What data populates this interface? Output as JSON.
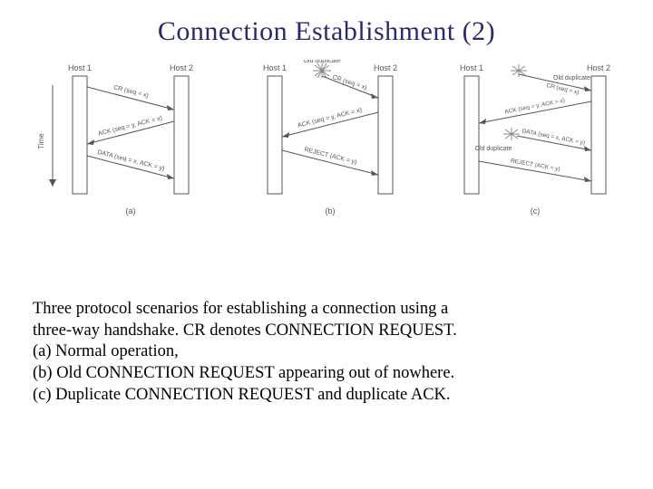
{
  "title": "Connection Establishment (2)",
  "panels": [
    {
      "label": "(a)",
      "host_left": "Host 1",
      "host_right": "Host 2",
      "time_label": "Time",
      "old_duplicate_top": false,
      "old_duplicate_mid": false,
      "messages": [
        "CR (seq = x)",
        "ACK (seq = y, ACK = x)",
        "DATA (seq = x, ACK = y)"
      ]
    },
    {
      "label": "(b)",
      "host_left": "Host 1",
      "host_right": "Host 2",
      "time_label": "",
      "old_duplicate_top": true,
      "old_duplicate_mid": false,
      "messages": [
        "CR (seq = x)",
        "ACK (seq = y, ACK = x)",
        "REJECT (ACK = y)"
      ]
    },
    {
      "label": "(c)",
      "host_left": "Host 1",
      "host_right": "Host 2",
      "time_label": "",
      "old_duplicate_top": true,
      "old_duplicate_mid": true,
      "messages": [
        "CR (seq = x)",
        "ACK (seq = y, ACK = x)",
        "DATA (seq = x, ACK = y)",
        "REJECT (ACK = y)"
      ]
    }
  ],
  "caption": {
    "line1": "Three protocol scenarios for establishing a connection using a",
    "line2": "three-way handshake.  CR denotes CONNECTION REQUEST.",
    "line3": "(a) Normal operation,",
    "line4": "(b) Old CONNECTION REQUEST appearing out of nowhere.",
    "line5": "(c) Duplicate CONNECTION REQUEST and duplicate ACK."
  }
}
